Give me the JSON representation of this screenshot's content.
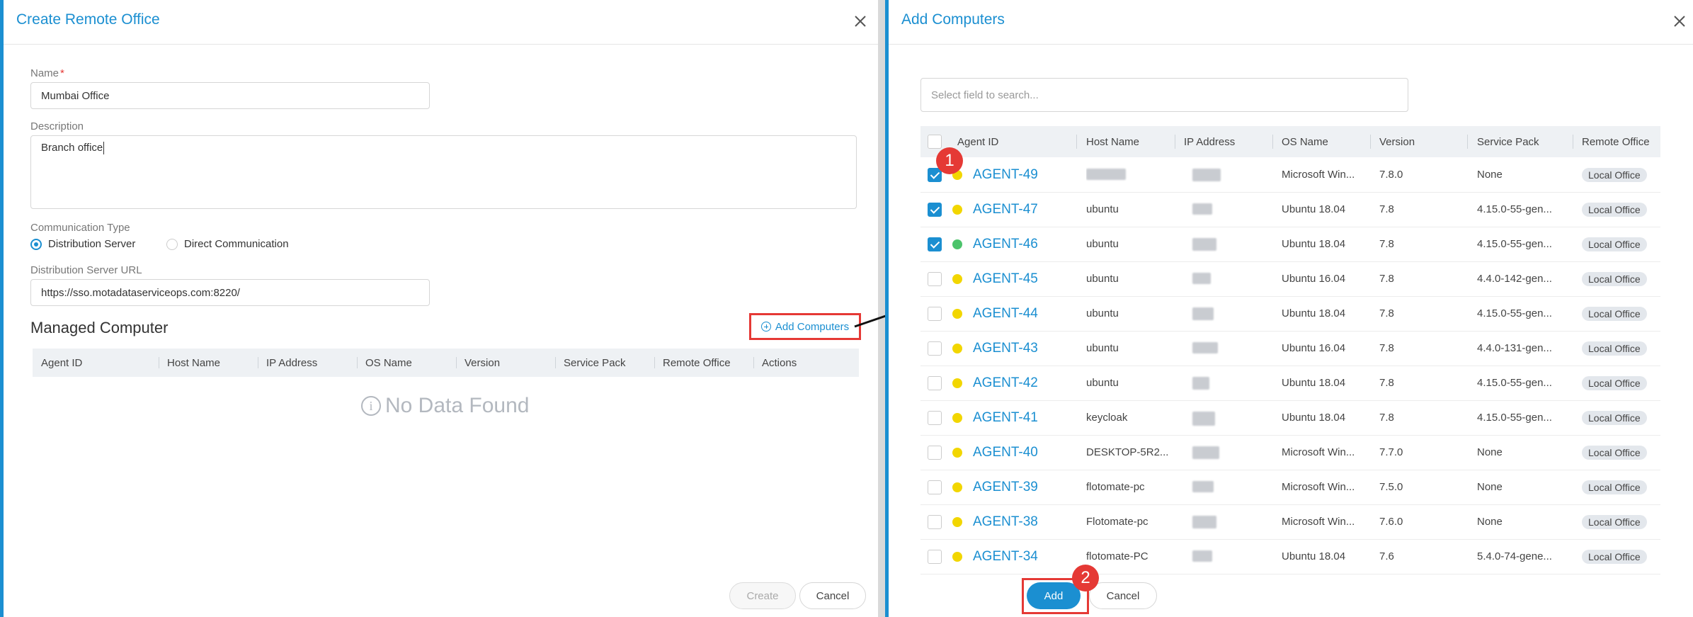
{
  "left_panel": {
    "title": "Create Remote Office",
    "name_label": "Name",
    "name_required_mark": "*",
    "name_value": "Mumbai Office",
    "description_label": "Description",
    "description_value": "Branch office",
    "communication_type_label": "Communication Type",
    "communication_options": [
      {
        "label": "Distribution Server",
        "selected": true
      },
      {
        "label": "Direct Communication",
        "selected": false
      }
    ],
    "distribution_url_label": "Distribution Server URL",
    "distribution_url_value": "https://sso.motadataserviceops.com:8220/",
    "managed_computer_title": "Managed Computer",
    "add_computers_link": "Add Computers",
    "table_headers": [
      "Agent ID",
      "Host Name",
      "IP Address",
      "OS Name",
      "Version",
      "Service Pack",
      "Remote Office",
      "Actions"
    ],
    "empty_text": "No Data Found",
    "create_button": "Create",
    "cancel_button": "Cancel"
  },
  "right_panel": {
    "title": "Add Computers",
    "search_placeholder": "Select field to search...",
    "table_headers": [
      "Agent ID",
      "Host Name",
      "IP Address",
      "OS Name",
      "Version",
      "Service Pack",
      "Remote Office"
    ],
    "rows": [
      {
        "checked": true,
        "status_color": "#f2d600",
        "agent_id": "AGENT-49",
        "host": "",
        "os": "Microsoft Win...",
        "version": "7.8.0",
        "service_pack": "None",
        "remote_office": "Local Office"
      },
      {
        "checked": true,
        "status_color": "#f2d600",
        "agent_id": "AGENT-47",
        "host": "ubuntu",
        "os": "Ubuntu 18.04",
        "version": "7.8",
        "service_pack": "4.15.0-55-gen...",
        "remote_office": "Local Office"
      },
      {
        "checked": true,
        "status_color": "#4cc36b",
        "agent_id": "AGENT-46",
        "host": "ubuntu",
        "os": "Ubuntu 18.04",
        "version": "7.8",
        "service_pack": "4.15.0-55-gen...",
        "remote_office": "Local Office"
      },
      {
        "checked": false,
        "status_color": "#f2d600",
        "agent_id": "AGENT-45",
        "host": "ubuntu",
        "os": "Ubuntu 16.04",
        "version": "7.8",
        "service_pack": "4.4.0-142-gen...",
        "remote_office": "Local Office"
      },
      {
        "checked": false,
        "status_color": "#f2d600",
        "agent_id": "AGENT-44",
        "host": "ubuntu",
        "os": "Ubuntu 18.04",
        "version": "7.8",
        "service_pack": "4.15.0-55-gen...",
        "remote_office": "Local Office"
      },
      {
        "checked": false,
        "status_color": "#f2d600",
        "agent_id": "AGENT-43",
        "host": "ubuntu",
        "os": "Ubuntu 16.04",
        "version": "7.8",
        "service_pack": "4.4.0-131-gen...",
        "remote_office": "Local Office"
      },
      {
        "checked": false,
        "status_color": "#f2d600",
        "agent_id": "AGENT-42",
        "host": "ubuntu",
        "os": "Ubuntu 18.04",
        "version": "7.8",
        "service_pack": "4.15.0-55-gen...",
        "remote_office": "Local Office"
      },
      {
        "checked": false,
        "status_color": "#f2d600",
        "agent_id": "AGENT-41",
        "host": "keycloak",
        "os": "Ubuntu 18.04",
        "version": "7.8",
        "service_pack": "4.15.0-55-gen...",
        "remote_office": "Local Office"
      },
      {
        "checked": false,
        "status_color": "#f2d600",
        "agent_id": "AGENT-40",
        "host": "DESKTOP-5R2...",
        "os": "Microsoft Win...",
        "version": "7.7.0",
        "service_pack": "None",
        "remote_office": "Local Office"
      },
      {
        "checked": false,
        "status_color": "#f2d600",
        "agent_id": "AGENT-39",
        "host": "flotomate-pc",
        "os": "Microsoft Win...",
        "version": "7.5.0",
        "service_pack": "None",
        "remote_office": "Local Office"
      },
      {
        "checked": false,
        "status_color": "#f2d600",
        "agent_id": "AGENT-38",
        "host": "Flotomate-pc",
        "os": "Microsoft Win...",
        "version": "7.6.0",
        "service_pack": "None",
        "remote_office": "Local Office"
      },
      {
        "checked": false,
        "status_color": "#f2d600",
        "agent_id": "AGENT-34",
        "host": "flotomate-PC",
        "os": "Ubuntu 18.04",
        "version": "7.6",
        "service_pack": "5.4.0-74-gene...",
        "remote_office": "Local Office"
      }
    ],
    "add_button": "Add",
    "cancel_button": "Cancel"
  },
  "annotations": {
    "step_1": "1",
    "step_2": "2",
    "highlight_color": "#e53935"
  },
  "colors": {
    "accent": "#1b8fd1",
    "status_yellow": "#f2d600",
    "status_green": "#4cc36b"
  }
}
